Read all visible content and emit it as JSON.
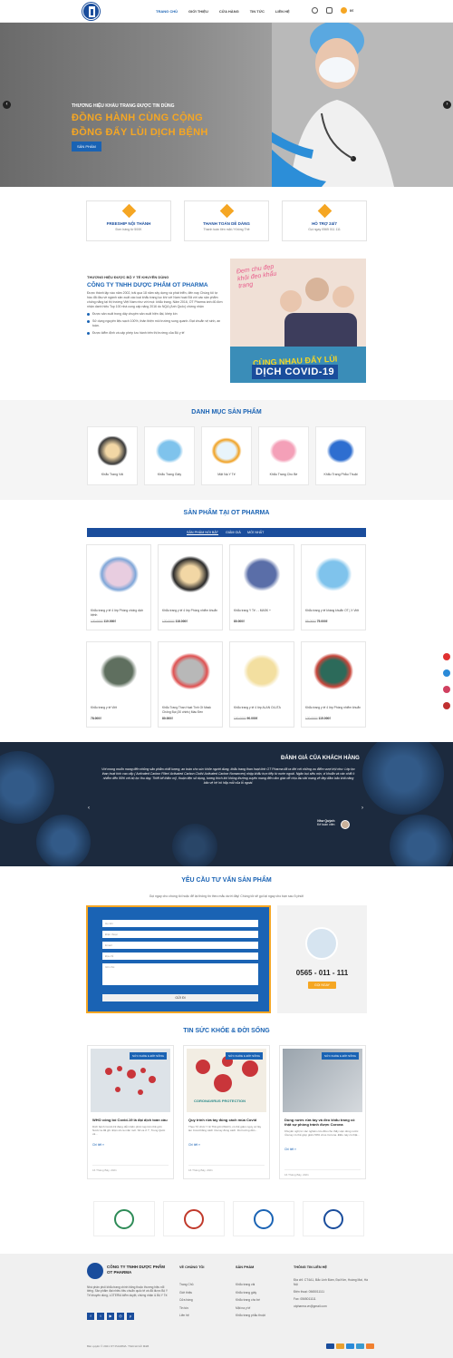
{
  "header": {
    "nav": [
      "TRANG CHỦ",
      "GIỚI THIỆU",
      "CỬA HÀNG",
      "TIN TỨC",
      "LIÊN HỆ"
    ],
    "cart_count": "0₫"
  },
  "hero": {
    "tagline": "THƯƠNG HIỆU KHẨU TRANG ĐƯỢC TIN DÙNG",
    "line1": "ĐỒNG HÀNH CÙNG CỘNG",
    "line2": "ĐỒNG ĐẨY LÙI DỊCH BỆNH",
    "button": "SẢN PHẨM"
  },
  "features": [
    {
      "title": "FREESHIP NỘI THÀNH",
      "sub": "Đơn hàng từ 500K"
    },
    {
      "title": "THANH TOÁN DỄ DÀNG",
      "sub": "Thanh toán tiền mặt / Không Thẻ"
    },
    {
      "title": "HỖ TRỢ 24/7",
      "sub": "Gọi ngay 0565 011 111"
    }
  ],
  "about": {
    "small": "THƯƠNG HIỆU ĐƯỢC BỘ Y TẾ KHUYÊN DÙNG",
    "title": "CÔNG TY TNHH DƯỢC PHẨM OT PHARMA",
    "p": "Được thành lập vào năm 2002, trải qua 18 năm xây dựng và phát triển, đến nay Chúng tôi tự hào đã đầu về ngành sản xuất các loại khẩu trang lọc khí với Nam hoạt Đã với các sản phẩm chống nắng tại thị trường Việt Nam như với mọi: khẩu trang. Năm 2016, OT Pharma ánh đủ đơn nhận danh hiệu Top 100 nhà cung cấp năng 2016 do NQA (Anh Quốc) chứng nhận",
    "bullets": [
      "Được sản xuất trong dây chuyền sản xuất hiện đại, khép kín",
      "Sử dụng nguyên liệu sạch 100%, thân thiện môi trường sung quanh. Đạt chuẩn vệ sinh, an toàn.",
      "Được kiểm định và cấp phép lưu hành trên thị trường của Bộ y tế"
    ],
    "img_hand": "Đem chu đẹp khỏi đeo khẩu trang",
    "img_cap_top": "CÙNG NHAU ĐẨY LÙI",
    "img_cap": "DỊCH COVID-19"
  },
  "categories": {
    "title": "DANH MỤC SẢN PHẨM",
    "items": [
      "Khẩu Trang Vải",
      "Khẩu Trang Giấy",
      "Mặt Nạ Y Tế",
      "Khẩu Trang Cho Bé",
      "Khẩu Trang Phẫu Thuật"
    ]
  },
  "products": {
    "title": "SẢN PHẨM TẠI OT PHARMA",
    "tabs": [
      "SẢN PHẨM NỔI BẬT",
      "GIẢM GIÁ",
      "MỚI NHẤT"
    ],
    "items": [
      {
        "name": "Khẩu trang y tế 4 lớp Phòng chống dịch bệnh",
        "old": "120.000₫",
        "price": "110.000₫"
      },
      {
        "name": "Khẩu trang y tế 4 lớp Phòng nhiễm khuẩn",
        "old": "120.000₫",
        "price": "118.000₫"
      },
      {
        "name": "Khẩu trang Y Tế - - MASK +",
        "old": "",
        "price": "80.000₫"
      },
      {
        "name": "Khẩu trang y tế kháng khuẩn OT | X Việt",
        "old": "85.000₫",
        "price": "75.000₫"
      },
      {
        "name": "Khẩu trang y tế Việt",
        "old": "",
        "price": "78.000₫"
      },
      {
        "name": "Khẩu Trang Than Hoạt Tính Ot Mask Chống Bụi (30 chiếc) Màu Đen",
        "old": "",
        "price": "80.000₫"
      },
      {
        "name": "Khẩu trang y tế 4 lớp ALAN OLUTA",
        "old": "100.000₫",
        "price": "90.000₫"
      },
      {
        "name": "Khẩu trang y tế 4 lớp Phòng nhiễm khuẩn",
        "old": "120.000₫",
        "price": "115.000₫"
      }
    ]
  },
  "reviews": {
    "title": "ĐÁNH GIÁ CỦA KHÁCH HÀNG",
    "text": "Với mong muốn mang đến những sản phẩm chất lượng, an toàn cho sức khỏe người dùng, khẩu trang than hoạt tính OT Pharma đã ra đời với những ưu điểm vượt trội như: Lớp lọc than hoạt tính cao cấp ( Activated Carbon Filter/ Activated Carbon Cloth/ Activated Carbon Nonwoven) nhập khẩu trực tiếp từ nước ngoài. Ngăn bụi siêu mịn, vi khuẩn và các chất ô nhiễm đến 95% với bộ lọc thu dạy. Thiết kế thẩm mỹ, thuận tiện sử dụng, tương thích khi không thường xuyên mang đến cảm giác dễ chịu lâu dài mang vẻ đẹp đảm bảo khả năng bảo vệ hệ hô hấp mỗi của lỗ ngoài.",
    "name": "Như Quỳnh",
    "role": "Kế toán viên"
  },
  "consult": {
    "title": "YÊU CẦU TƯ VẤN SẢN PHẨM",
    "sub": "Gọi ngay cho chúng tôi hoặc để lại thông tin theo mẫu dưới đây! Chúng tôi sẽ gọi lại ngay cho bạn sau 5 phút!",
    "fields": [
      "Họ tên",
      "Điện thoại",
      "Email",
      "Địa chỉ",
      "Ghi chú"
    ],
    "submit": "GỬI ĐI",
    "phone": "0565 - 011 - 111",
    "call": "GỌI NGAY"
  },
  "news": {
    "title": "TIN SỨC KHỎE & ĐỜI SỐNG",
    "tag": "SỨC KHỎE & ĐỜI SỐNG",
    "more": "Chi tiết »",
    "items": [
      {
        "title": "WHO công bố Covid-19 là đại dịch toàn cầu",
        "desc": "Dịch bệnh Covid-19 đang diễn biến phức tạp trên thế giới. Nước ta đã ghi nhận số ca mắc mới. Số ca ở Ý, Trung Quốc và...",
        "date": "16 Tháng Bảy, 2021",
        "img_text": ""
      },
      {
        "title": "Quy trình rửa tay đúng cách mùa Covid",
        "desc": "Theo Tổ chức Y tế Thế giới (WHO), có thể giảm nguy cơ lây lan Covid bằng cách rửa tay đúng cách. Dù hướng dẫn...",
        "date": "16 Tháng Bảy, 2021",
        "img_text": "CORONAVIRUS PROTECTION"
      },
      {
        "title": "Dùng nước rửa tay và đeo khẩu trang có thật sự phòng tránh được Corona",
        "desc": "Khuyến nghị từ các nghiên cứu đều cho thấy việc dùng nước rửa tay có thể giúp giảm 50% virus Corona. Điều này có thật...",
        "date": "16 Tháng Bảy, 2021",
        "img_text": ""
      }
    ]
  },
  "footer": {
    "company": "CÔNG TY TNHH DƯỢC PHẨM OT PHARMA",
    "desc": "Nhà phân phối khẩu trang chính hãng thuộc thương hiệu nổi tiếng. Sản phẩm đạt nhiều tiêu chuẩn quốc tế và đã được Bộ Y Tế khuyên dùng, LOTERIA kiểm duyệt, chứng nhận & Bộ Y Tế.",
    "col1_title": "VỀ CHÚNG TÔI",
    "col1": [
      "Trang Chủ",
      "Giới thiệu",
      "Cửa hàng",
      "Tin tức",
      "Liên hệ"
    ],
    "col2_title": "SẢN PHẨM",
    "col2": [
      "Khẩu trang vải",
      "Khẩu trang giấy",
      "Khẩu trang cho bé",
      "Mặt nạ y tế",
      "Khẩu trang phẫu thuật"
    ],
    "col3_title": "THÔNG TIN LIÊN HỆ",
    "address": "Địa chỉ: CT4A1, Bắc Linh Đàm, Đại Kim, Hoàng Mai, Hà Nội",
    "phone": "Điện thoại: 0565011111",
    "fax": "Fax: 0565011111",
    "email": "otpharma.vn@gmail.com",
    "copy": "Bản quyền © 2021 OT PHARMA. Thiết kế bởi M&B"
  },
  "colors": {
    "primary": "#1a63b4",
    "dark": "#1a4d9c",
    "accent": "#f5a623"
  }
}
